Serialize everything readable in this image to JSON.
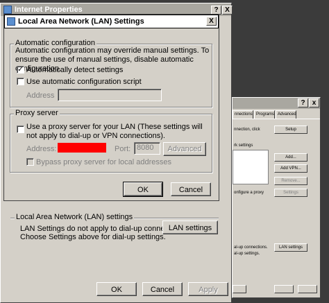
{
  "background_window": {
    "tabs": [
      "nnections",
      "Programs",
      "Advanced"
    ],
    "texts": {
      "connection_click": "nnection, click",
      "network_settings": "rk settings",
      "configure_proxy": "onfigure a proxy",
      "dialup_1": "al-up connections.",
      "dialup_2": "al-up settings."
    },
    "buttons": {
      "setup": "Setup",
      "add": "Add...",
      "add_vpn": "Add VPN...",
      "remove": "Remove...",
      "settings": "Settings",
      "lan_settings": "LAN settings"
    }
  },
  "ie_properties": {
    "title": "Internet Properties",
    "title_help": "?",
    "title_close": "X",
    "lan_group_label": "Local Area Network (LAN) settings",
    "lan_desc_line1": "LAN Settings do not apply to dial-up connections.",
    "lan_desc_line2": "Choose Settings above for dial-up settings.",
    "lan_settings_button": "LAN settings",
    "ok": "OK",
    "cancel": "Cancel",
    "apply": "Apply"
  },
  "lan_dialog": {
    "title": "Local Area Network (LAN) Settings",
    "close": "X",
    "auto_config": {
      "label": "Automatic configuration",
      "description": "Automatic configuration may override manual settings.  To ensure the use of manual settings, disable automatic configuration.",
      "auto_detect_label": "Automatically detect settings",
      "auto_detect_checked": true,
      "use_script_label": "Use automatic configuration script",
      "use_script_checked": false,
      "address_label": "Address",
      "address_value": ""
    },
    "proxy": {
      "label": "Proxy server",
      "use_proxy_label": "Use a proxy server for your LAN (These settings will not apply to dial-up or VPN connections).",
      "use_proxy_checked": false,
      "address_label": "Address:",
      "redacted_color": "#ff0000",
      "port_label": "Port:",
      "port_value": "8080",
      "advanced_button": "Advanced",
      "bypass_label": "Bypass proxy server for local addresses",
      "bypass_checked": false
    },
    "ok": "OK",
    "cancel": "Cancel"
  }
}
